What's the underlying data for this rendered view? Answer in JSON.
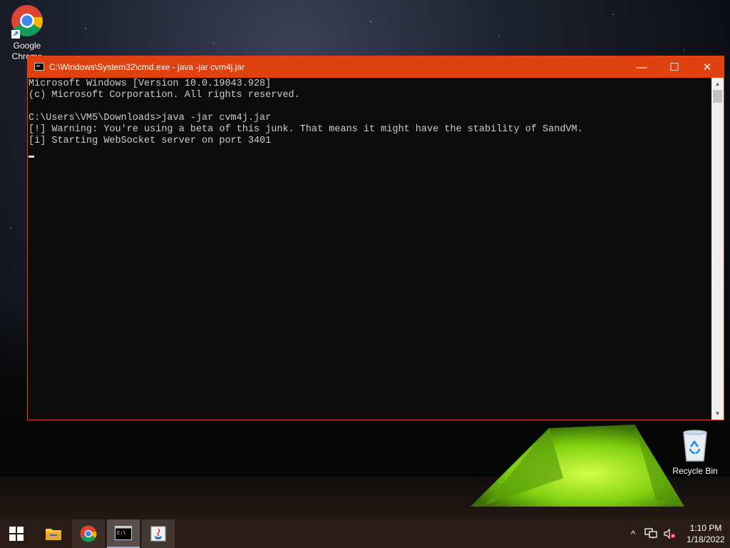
{
  "desktop": {
    "icons": [
      {
        "label": "Google Chrome",
        "icon": "chrome-icon"
      },
      {
        "label": "Recycle Bin",
        "icon": "recycle-bin-icon"
      }
    ]
  },
  "window": {
    "title": "C:\\Windows\\System32\\cmd.exe - java  -jar cvm4j.jar",
    "minimize": "—",
    "maximize": "☐",
    "close": "✕",
    "accent": "#e0420f",
    "lines": [
      "Microsoft Windows [Version 10.0.19043.928]",
      "(c) Microsoft Corporation. All rights reserved.",
      "",
      "C:\\Users\\VM5\\Downloads>java -jar cvm4j.jar",
      "[!] Warning: You're using a beta of this junk. That means it might have the stability of SandVM.",
      "[i] Starting WebSocket server on port 3401"
    ]
  },
  "taskbar": {
    "items": [
      {
        "name": "start-button",
        "icon": "windows-logo-icon"
      },
      {
        "name": "file-explorer",
        "icon": "folder-icon"
      },
      {
        "name": "chrome",
        "icon": "chrome-icon"
      },
      {
        "name": "cmd",
        "icon": "cmd-icon",
        "active": true
      },
      {
        "name": "java",
        "icon": "java-icon"
      }
    ],
    "tray": {
      "chevron": "^",
      "time": "1:10 PM",
      "date": "1/18/2022"
    }
  }
}
